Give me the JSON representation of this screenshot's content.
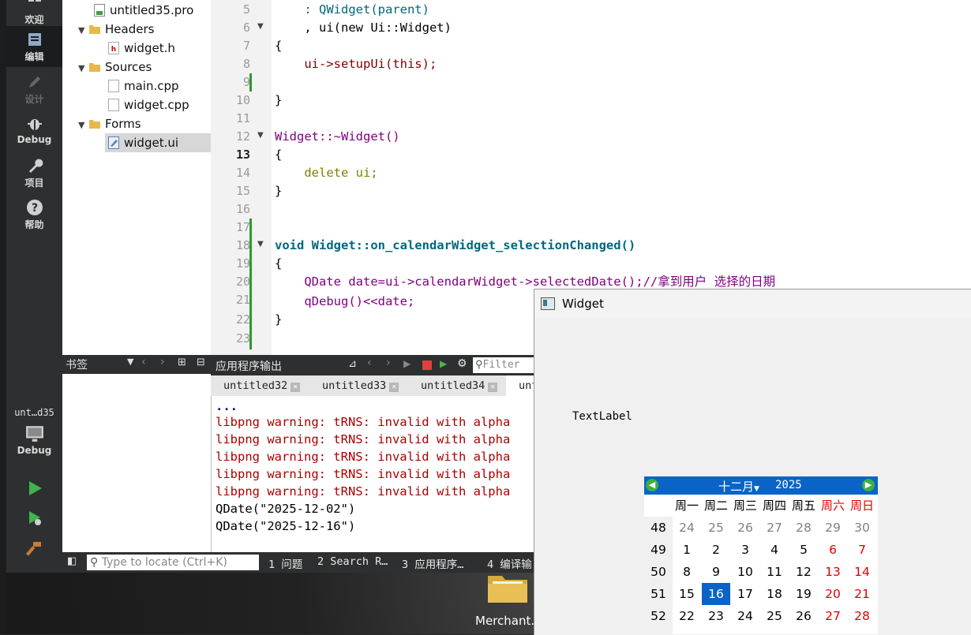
{
  "modebar": {
    "welcome": "欢迎",
    "edit": "编辑",
    "design": "设计",
    "debug": "Debug",
    "projects": "项目",
    "help": "帮助",
    "kit_project": "unt…d35",
    "kit_build": "Debug"
  },
  "tree": {
    "pro_file": "untitled35.pro",
    "headers": "Headers",
    "widget_h": "widget.h",
    "sources": "Sources",
    "main_cpp": "main.cpp",
    "widget_cpp": "widget.cpp",
    "forms": "Forms",
    "widget_ui": "widget.ui"
  },
  "editor": {
    "line_numbers": [
      "5",
      "6",
      "7",
      "8",
      "9",
      "10",
      "11",
      "12",
      "13",
      "14",
      "15",
      "16",
      "17",
      "18",
      "19",
      "20",
      "21",
      "22",
      "23"
    ],
    "current_line": "13",
    "code": {
      "l5": "    : QWidget(parent)",
      "l6": "    , ui(new Ui::Widget)",
      "l7": "{",
      "l8": "    ui->setupUi(this);",
      "l10": "}",
      "l12": "Widget::~Widget()",
      "l13": "{",
      "l14": "    delete ui;",
      "l15": "}",
      "l18": "void Widget::on_calendarWidget_selectionChanged()",
      "l19": "{",
      "l20": "    QDate date=ui->calendarWidget->selectedDate();//拿到用户 选择的日期",
      "l21": "    qDebug()<<date;",
      "l22": "}"
    }
  },
  "bookmarks": {
    "title": "书签"
  },
  "output": {
    "title": "应用程序输出",
    "filter_placeholder": "Filter",
    "tabs": [
      "untitled32",
      "untitled33",
      "untitled34",
      "unt"
    ],
    "ellipsis": "...",
    "lines": [
      "libpng warning: tRNS: invalid with alpha",
      "libpng warning: tRNS: invalid with alpha",
      "libpng warning: tRNS: invalid with alpha",
      "libpng warning: tRNS: invalid with alpha",
      "libpng warning: tRNS: invalid with alpha",
      "QDate(\"2025-12-02\")",
      "QDate(\"2025-12-16\")"
    ]
  },
  "statusbar": {
    "locator_placeholder": "Type to locate (Ctrl+K)",
    "issues": "1 问题",
    "search": "2 Search R…",
    "app_output": "3 应用程序…",
    "compile": "4 编译输"
  },
  "widget_window": {
    "title": "Widget",
    "text_label": "TextLabel"
  },
  "calendar": {
    "month": "十二月",
    "year": "2025",
    "weekdays": [
      "周一",
      "周二",
      "周三",
      "周四",
      "周五",
      "周六",
      "周日"
    ],
    "weeks": [
      {
        "wk": "48",
        "days": [
          "24",
          "25",
          "26",
          "27",
          "28",
          "29",
          "30"
        ],
        "gray": true
      },
      {
        "wk": "49",
        "days": [
          "1",
          "2",
          "3",
          "4",
          "5",
          "6",
          "7"
        ]
      },
      {
        "wk": "50",
        "days": [
          "8",
          "9",
          "10",
          "11",
          "12",
          "13",
          "14"
        ]
      },
      {
        "wk": "51",
        "days": [
          "15",
          "16",
          "17",
          "18",
          "19",
          "20",
          "21"
        ]
      },
      {
        "wk": "52",
        "days": [
          "22",
          "23",
          "24",
          "25",
          "26",
          "27",
          "28"
        ]
      }
    ],
    "selected_day": "16",
    "colors": {
      "header": "#0a64c8",
      "weekend": "#e00000",
      "selected": "#0a64c8"
    }
  },
  "desktop": {
    "icon_label": "Merchant."
  }
}
